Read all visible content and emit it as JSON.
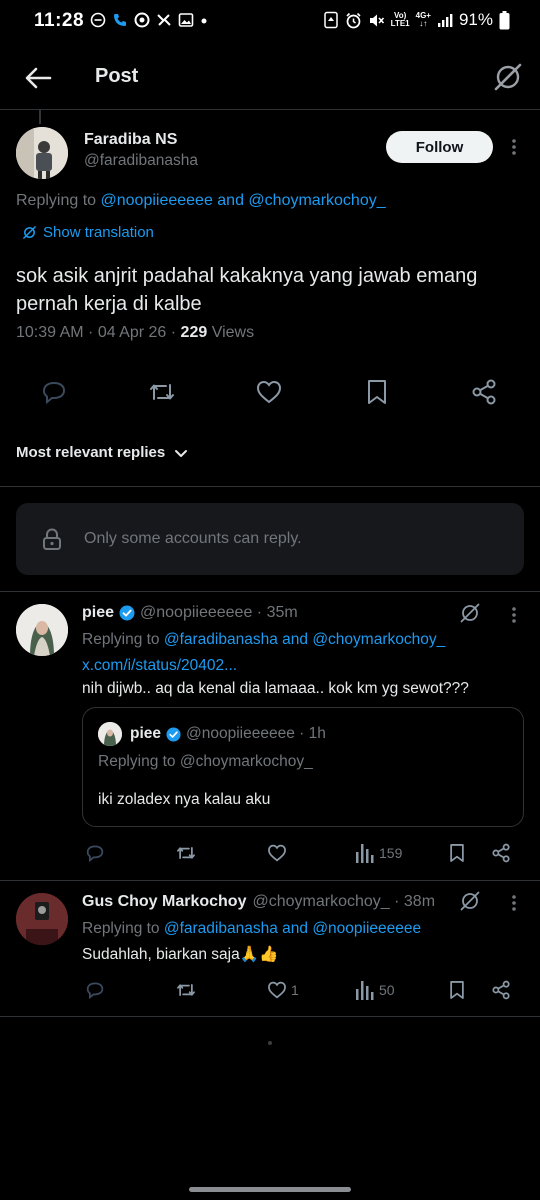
{
  "status_bar": {
    "time": "11:28",
    "battery": "91%",
    "volte_top": "Vo)",
    "volte_bottom": "LTE1",
    "net_top": "4G+",
    "net_bottom": "↓↑"
  },
  "header": {
    "title": "Post"
  },
  "main_post": {
    "author_name": "Faradiba NS",
    "author_handle": "@faradibanasha",
    "follow_label": "Follow",
    "replying_prefix": "Replying to",
    "replying_to": "@noopiieeeeee and @choymarkochoy_",
    "translate_label": "Show translation",
    "text": "sok asik anjrit padahal kakaknya yang jawab emang pernah kerja di kalbe",
    "time": "10:39 AM · 04 Apr 26 · ",
    "views_count": "229",
    "views_label": " Views"
  },
  "sort": {
    "label": "Most relevant replies"
  },
  "restriction": {
    "text": "Only some accounts can reply."
  },
  "replies": [
    {
      "name": "piee",
      "handle": "@noopiieeeeee · 35m",
      "replying_prefix": "Replying to",
      "replying_to": "@faradibanasha and @choymarkochoy_",
      "link": "x.com/i/status/20402...",
      "text": "nih dijwb.. aq da kenal dia lamaaa.. kok km yg sewot???",
      "views": "159",
      "quote": {
        "name": "piee",
        "handle": "@noopiieeeeee · 1h",
        "replying": "Replying to @choymarkochoy_",
        "text": "iki zoladex nya kalau aku"
      }
    },
    {
      "name": "Gus Choy Markochoy",
      "handle": "@choymarkochoy_ · 38m",
      "replying_prefix": "Replying to",
      "replying_to": "@faradibanasha and @noopiieeeeee",
      "text": "Sudahlah, biarkan saja🙏👍",
      "likes": "1",
      "views": "50"
    }
  ],
  "colors": {
    "background": "#000000",
    "text": "#e7e9ea",
    "muted": "#71767b",
    "link": "#1d9bf0",
    "divider": "#2f3336",
    "verified": "#1d9bf0"
  }
}
